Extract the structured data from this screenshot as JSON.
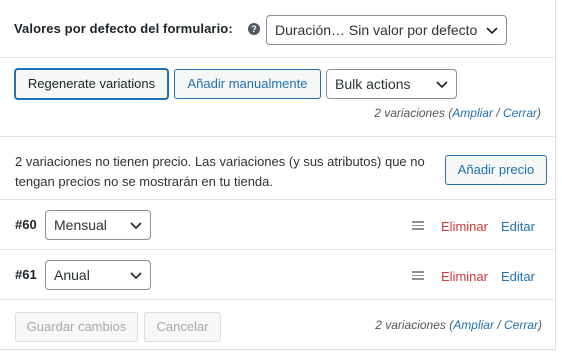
{
  "defaults": {
    "label": "Valores por defecto del formulario:",
    "help_icon": "?",
    "select_value": "Duración… Sin valor por defecto"
  },
  "actions": {
    "regenerate_label": "Regenerate variations",
    "add_manual_label": "Añadir manualmente",
    "bulk_select_value": "Bulk actions"
  },
  "count": {
    "text": "2 variaciones",
    "paren_open": "(",
    "expand_label": "Ampliar",
    "separator": "/",
    "close_label": "Cerrar",
    "paren_close": ")"
  },
  "notice": {
    "text": "2 variaciones no tienen precio. Las variaciones (y sus atributos) que no tengan precios no se mostrarán en tu tienda.",
    "add_price_label": "Añadir precio"
  },
  "variations": [
    {
      "id": "#60",
      "value": "Mensual",
      "delete_label": "Eliminar",
      "edit_label": "Editar"
    },
    {
      "id": "#61",
      "value": "Anual",
      "delete_label": "Eliminar",
      "edit_label": "Editar"
    }
  ],
  "footer": {
    "save_label": "Guardar cambios",
    "cancel_label": "Cancelar"
  },
  "icons": {
    "help": "help-icon",
    "chevron": "chevron-down-icon",
    "drag": "drag-handle-icon"
  },
  "colors": {
    "link": "#2271b1",
    "delete": "#d63638",
    "disabled_text": "#a7aaad"
  }
}
